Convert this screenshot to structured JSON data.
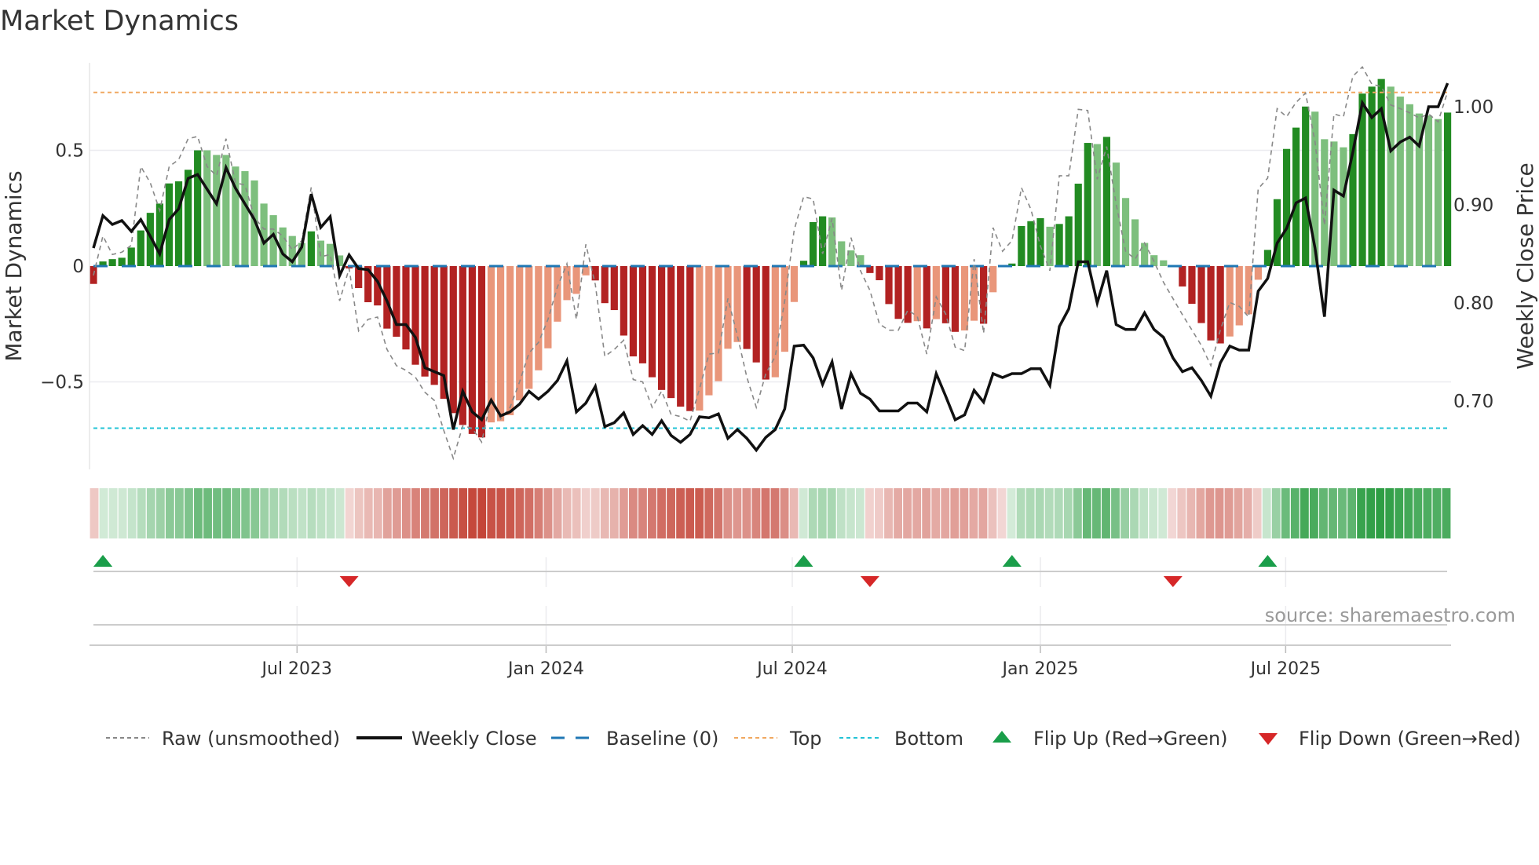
{
  "title": "Market Dynamics",
  "source": "source: sharemaestro.com",
  "colors": {
    "up_strong": "#228b22",
    "up_weak": "#7dbf7d",
    "down_strong": "#b22222",
    "down_weak": "#e9967a",
    "price": "#111111",
    "raw": "#888888",
    "baseline": "#1f77b4",
    "top": "#f0a860",
    "bottom": "#22c3d6",
    "flip_up": "#1a9e4a",
    "flip_down": "#d62728",
    "strip_green": "#2e9e44",
    "strip_red": "#c0392b"
  },
  "chart_data": {
    "type": "bar",
    "title": "Market Dynamics",
    "ylabel": "Market Dynamics",
    "y2label": "Weekly Close Price",
    "ylim": [
      -0.88,
      0.9
    ],
    "y2lim": [
      0.642,
      1.04
    ],
    "yticks": [
      {
        "v": 0.5,
        "label": "0.5"
      },
      {
        "v": 0,
        "label": "0"
      },
      {
        "v": -0.5,
        "label": "−0.5"
      }
    ],
    "y2ticks": [
      {
        "v": 1.0,
        "label": "1.00"
      },
      {
        "v": 0.9,
        "label": "0.90"
      },
      {
        "v": 0.8,
        "label": "0.80"
      },
      {
        "v": 0.7,
        "label": "0.70"
      }
    ],
    "xticks": [
      {
        "week": 21.5,
        "label": "Jul 2023"
      },
      {
        "week": 47.8,
        "label": "Jan 2024"
      },
      {
        "week": 73.8,
        "label": "Jul 2024"
      },
      {
        "week": 100,
        "label": "Jan 2025"
      },
      {
        "week": 125.9,
        "label": "Jul 2025"
      }
    ],
    "top_level": 0.75,
    "bottom_level": -0.7,
    "baseline": 0,
    "grid": true,
    "legend_position": "bottom",
    "legend": [
      {
        "key": "raw",
        "label": "Raw (unsmoothed)"
      },
      {
        "key": "price",
        "label": "Weekly Close"
      },
      {
        "key": "baseline",
        "label": "Baseline (0)"
      },
      {
        "key": "top",
        "label": "Top"
      },
      {
        "key": "bottom",
        "label": "Bottom"
      },
      {
        "key": "flip_up",
        "label": "Flip Up (Red→Green)"
      },
      {
        "key": "flip_down",
        "label": "Flip Down (Green→Red)"
      }
    ],
    "momentum": [
      -0.077,
      0.02,
      0.03,
      0.036,
      0.08,
      0.154,
      0.23,
      0.27,
      0.357,
      0.366,
      0.416,
      0.5,
      0.5,
      0.48,
      0.48,
      0.43,
      0.41,
      0.37,
      0.27,
      0.22,
      0.167,
      0.13,
      0.1,
      0.15,
      0.11,
      0.096,
      0.046,
      -0.01,
      -0.095,
      -0.156,
      -0.17,
      -0.27,
      -0.305,
      -0.36,
      -0.426,
      -0.477,
      -0.513,
      -0.573,
      -0.635,
      -0.686,
      -0.725,
      -0.74,
      -0.675,
      -0.67,
      -0.644,
      -0.58,
      -0.53,
      -0.45,
      -0.355,
      -0.24,
      -0.147,
      -0.12,
      -0.04,
      -0.062,
      -0.16,
      -0.19,
      -0.3,
      -0.39,
      -0.42,
      -0.48,
      -0.535,
      -0.57,
      -0.607,
      -0.626,
      -0.624,
      -0.558,
      -0.497,
      -0.357,
      -0.328,
      -0.358,
      -0.416,
      -0.49,
      -0.48,
      -0.37,
      -0.155,
      0.023,
      0.19,
      0.215,
      0.21,
      0.107,
      0.068,
      0.047,
      -0.03,
      -0.061,
      -0.164,
      -0.228,
      -0.245,
      -0.238,
      -0.269,
      -0.229,
      -0.247,
      -0.284,
      -0.278,
      -0.236,
      -0.249,
      -0.113,
      -0.005,
      0.011,
      0.173,
      0.194,
      0.207,
      0.17,
      0.182,
      0.215,
      0.356,
      0.532,
      0.527,
      0.558,
      0.447,
      0.294,
      0.202,
      0.1,
      0.047,
      0.025,
      -0.005,
      -0.088,
      -0.163,
      -0.246,
      -0.321,
      -0.334,
      -0.304,
      -0.256,
      -0.208,
      -0.059,
      0.07,
      0.289,
      0.506,
      0.598,
      0.689,
      0.667,
      0.548,
      0.538,
      0.513,
      0.57,
      0.745,
      0.775,
      0.808,
      0.775,
      0.732,
      0.699,
      0.659,
      0.65,
      0.635,
      0.663
    ],
    "raw": [
      -0.04,
      0.13,
      0.05,
      0.06,
      0.09,
      0.43,
      0.36,
      0.24,
      0.43,
      0.46,
      0.55,
      0.56,
      0.43,
      0.39,
      0.55,
      0.36,
      0.35,
      0.21,
      0.16,
      0.16,
      0.13,
      0.07,
      0.11,
      0.34,
      0.04,
      0.05,
      -0.15,
      -0.01,
      -0.28,
      -0.23,
      -0.22,
      -0.36,
      -0.43,
      -0.45,
      -0.48,
      -0.545,
      -0.58,
      -0.71,
      -0.83,
      -0.69,
      -0.7,
      -0.76,
      -0.57,
      -0.66,
      -0.61,
      -0.5,
      -0.375,
      -0.33,
      -0.23,
      -0.09,
      0.01,
      -0.23,
      0.094,
      -0.08,
      -0.39,
      -0.36,
      -0.32,
      -0.49,
      -0.5,
      -0.61,
      -0.54,
      -0.64,
      -0.65,
      -0.67,
      -0.53,
      -0.38,
      -0.375,
      -0.14,
      -0.3,
      -0.48,
      -0.61,
      -0.465,
      -0.39,
      -0.15,
      0.156,
      0.3,
      0.29,
      0.053,
      0.206,
      -0.105,
      0.123,
      -0.02,
      -0.105,
      -0.25,
      -0.277,
      -0.277,
      -0.19,
      -0.217,
      -0.38,
      -0.133,
      -0.207,
      -0.35,
      -0.365,
      0.03,
      -0.29,
      0.166,
      0.064,
      0.11,
      0.338,
      0.245,
      0.087,
      -0.02,
      0.39,
      0.39,
      0.677,
      0.672,
      0.375,
      0.516,
      0.268,
      0.064,
      0.03,
      0.1,
      0.02,
      -0.07,
      -0.14,
      -0.21,
      -0.276,
      -0.343,
      -0.43,
      -0.276,
      -0.157,
      -0.174,
      -0.22,
      0.334,
      0.38,
      0.68,
      0.645,
      0.707,
      0.747,
      0.538,
      0.176,
      0.657,
      0.645,
      0.82,
      0.86,
      0.786,
      0.775,
      0.696,
      0.68,
      0.662,
      0.64,
      0.657,
      0.623,
      0.753
    ],
    "price": [
      0.856,
      0.889,
      0.88,
      0.884,
      0.873,
      0.885,
      0.868,
      0.85,
      0.885,
      0.896,
      0.927,
      0.931,
      0.916,
      0.901,
      0.938,
      0.917,
      0.901,
      0.885,
      0.861,
      0.87,
      0.85,
      0.842,
      0.857,
      0.911,
      0.877,
      0.888,
      0.828,
      0.849,
      0.835,
      0.834,
      0.822,
      0.802,
      0.778,
      0.778,
      0.765,
      0.734,
      0.73,
      0.726,
      0.671,
      0.71,
      0.689,
      0.681,
      0.701,
      0.685,
      0.689,
      0.697,
      0.71,
      0.702,
      0.71,
      0.721,
      0.741,
      0.689,
      0.698,
      0.715,
      0.674,
      0.678,
      0.688,
      0.666,
      0.675,
      0.666,
      0.68,
      0.665,
      0.658,
      0.666,
      0.684,
      0.683,
      0.687,
      0.662,
      0.671,
      0.662,
      0.65,
      0.663,
      0.671,
      0.692,
      0.756,
      0.757,
      0.744,
      0.717,
      0.74,
      0.692,
      0.728,
      0.708,
      0.702,
      0.69,
      0.69,
      0.69,
      0.698,
      0.698,
      0.689,
      0.728,
      0.705,
      0.681,
      0.686,
      0.711,
      0.699,
      0.728,
      0.724,
      0.728,
      0.728,
      0.733,
      0.733,
      0.716,
      0.776,
      0.794,
      0.842,
      0.842,
      0.8,
      0.833,
      0.778,
      0.773,
      0.773,
      0.79,
      0.773,
      0.765,
      0.744,
      0.73,
      0.734,
      0.721,
      0.705,
      0.739,
      0.756,
      0.752,
      0.752,
      0.812,
      0.825,
      0.861,
      0.876,
      0.902,
      0.907,
      0.856,
      0.786,
      0.915,
      0.909,
      0.954,
      1.004,
      0.989,
      0.998,
      0.955,
      0.964,
      0.969,
      0.96,
      1.0,
      1.0,
      1.024
    ]
  }
}
